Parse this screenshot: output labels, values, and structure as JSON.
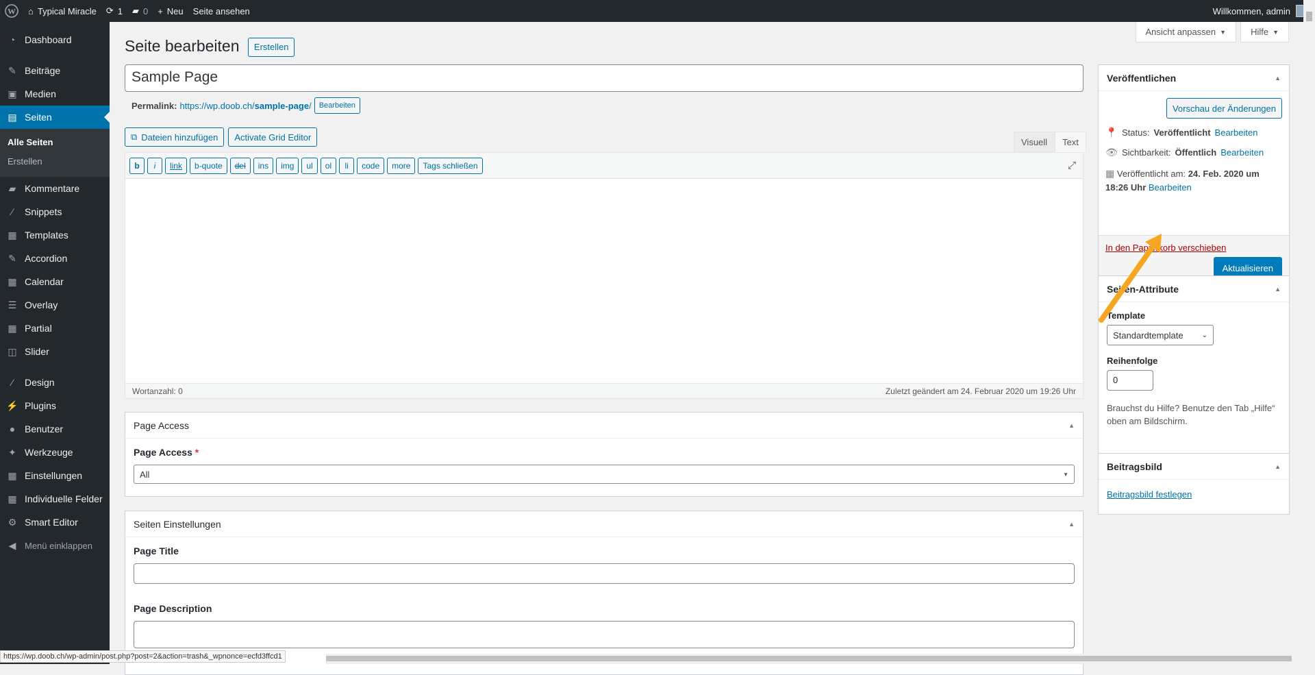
{
  "adminbar": {
    "site_name": "Typical Miracle",
    "updates_count": "1",
    "comments_count": "0",
    "new_label": "Neu",
    "view_label": "Seite ansehen",
    "welcome": "Willkommen, admin"
  },
  "sidebar": {
    "items": [
      {
        "label": "Dashboard",
        "icon": "dashboard-icon"
      },
      {
        "label": "Beiträge",
        "icon": "pin-icon"
      },
      {
        "label": "Medien",
        "icon": "media-icon"
      },
      {
        "label": "Seiten",
        "icon": "pages-icon"
      },
      {
        "label": "Kommentare",
        "icon": "comment-icon"
      },
      {
        "label": "Snippets",
        "icon": "brush-icon"
      },
      {
        "label": "Templates",
        "icon": "grid-icon"
      },
      {
        "label": "Accordion",
        "icon": "pin-icon"
      },
      {
        "label": "Calendar",
        "icon": "calendar-icon"
      },
      {
        "label": "Overlay",
        "icon": "list-icon"
      },
      {
        "label": "Partial",
        "icon": "grid-icon"
      },
      {
        "label": "Slider",
        "icon": "slider-icon"
      },
      {
        "label": "Design",
        "icon": "brush-icon"
      },
      {
        "label": "Plugins",
        "icon": "plugin-icon"
      },
      {
        "label": "Benutzer",
        "icon": "user-icon"
      },
      {
        "label": "Werkzeuge",
        "icon": "wrench-icon"
      },
      {
        "label": "Einstellungen",
        "icon": "settings-icon"
      },
      {
        "label": "Individuelle Felder",
        "icon": "grid-icon"
      },
      {
        "label": "Smart Editor",
        "icon": "gear-icon"
      }
    ],
    "submenu": [
      "Alle Seiten",
      "Erstellen"
    ],
    "collapse_label": "Menü einklappen"
  },
  "screen_tabs": {
    "options": "Ansicht anpassen",
    "help": "Hilfe"
  },
  "page": {
    "heading": "Seite bearbeiten",
    "create_button": "Erstellen",
    "title_value": "Sample Page",
    "permalink_label": "Permalink:",
    "permalink_base": "https://wp.doob.ch/",
    "permalink_slug": "sample-page",
    "permalink_end": "/",
    "permalink_edit": "Bearbeiten"
  },
  "editor": {
    "add_media": "Dateien hinzufügen",
    "grid_editor": "Activate Grid Editor",
    "tab_visual": "Visuell",
    "tab_text": "Text",
    "quicktags": [
      "b",
      "i",
      "link",
      "b-quote",
      "del",
      "ins",
      "img",
      "ul",
      "ol",
      "li",
      "code",
      "more",
      "Tags schließen"
    ],
    "word_count": "Wortanzahl: 0",
    "last_edited": "Zuletzt geändert am 24. Februar 2020 um 19:26 Uhr"
  },
  "page_access": {
    "title": "Page Access",
    "label": "Page Access",
    "required_mark": "*",
    "value": "All"
  },
  "seiten_einstellungen": {
    "title": "Seiten Einstellungen",
    "page_title_label": "Page Title",
    "page_description_label": "Page Description"
  },
  "publish": {
    "title": "Veröffentlichen",
    "preview_button": "Vorschau der Änderungen",
    "status_label": "Status:",
    "status_value": "Veröffentlicht",
    "visibility_label": "Sichtbarkeit:",
    "visibility_value": "Öffentlich",
    "published_label": "Veröffentlicht am:",
    "published_date": "24. Feb. 2020 um",
    "published_time": "18:26 Uhr",
    "edit_link": "Bearbeiten",
    "trash_link": "In den Papierkorb verschieben",
    "update_button": "Aktualisieren"
  },
  "attributes": {
    "title": "Seiten-Attribute",
    "template_label": "Template",
    "template_value": "Standardtemplate",
    "order_label": "Reihenfolge",
    "order_value": "0",
    "help_text": "Brauchst du Hilfe? Benutze den Tab „Hilfe“ oben am Bildschirm."
  },
  "featured": {
    "title": "Beitragsbild",
    "set_link": "Beitragsbild festlegen"
  },
  "status_url": "https://wp.doob.ch/wp-admin/post.php?post=2&action=trash&_wpnonce=ecfd3ffcd1",
  "colors": {
    "accent": "#0073aa",
    "sidebar": "#23282d",
    "annotation_arrow": "#f5a623"
  }
}
